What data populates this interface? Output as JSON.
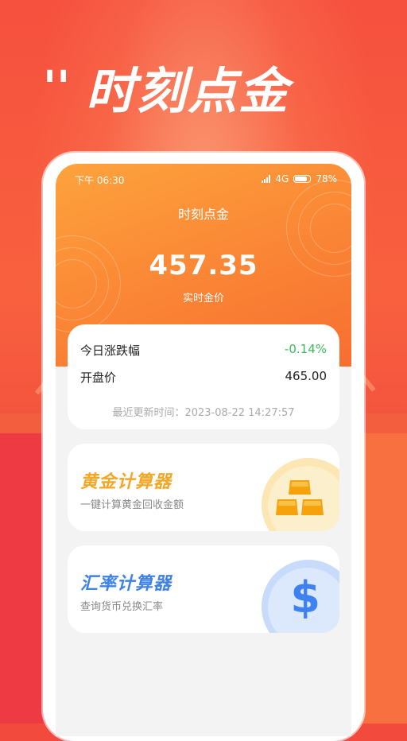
{
  "promo": {
    "quote_mark": "''",
    "title": "时刻点金"
  },
  "status_bar": {
    "time": "下午 06:30",
    "network": "4G",
    "battery": "78%"
  },
  "header": {
    "title": "时刻点金",
    "price": "457.35",
    "price_label": "实时金价"
  },
  "info_card": {
    "change_label": "今日涨跌幅",
    "change_value": "-0.14%",
    "open_label": "开盘价",
    "open_value": "465.00",
    "updated": "最近更新时间：2023-08-22  14:27:57"
  },
  "tools": [
    {
      "title": "黄金计算器",
      "subtitle": "一键计算黄金回收金额",
      "icon": "gold-bars-icon",
      "color": "#f5a623"
    },
    {
      "title": "汇率计算器",
      "subtitle": "查询货币兑换汇率",
      "icon": "dollar-icon",
      "color": "#3e82e8",
      "symbol": "$"
    }
  ]
}
